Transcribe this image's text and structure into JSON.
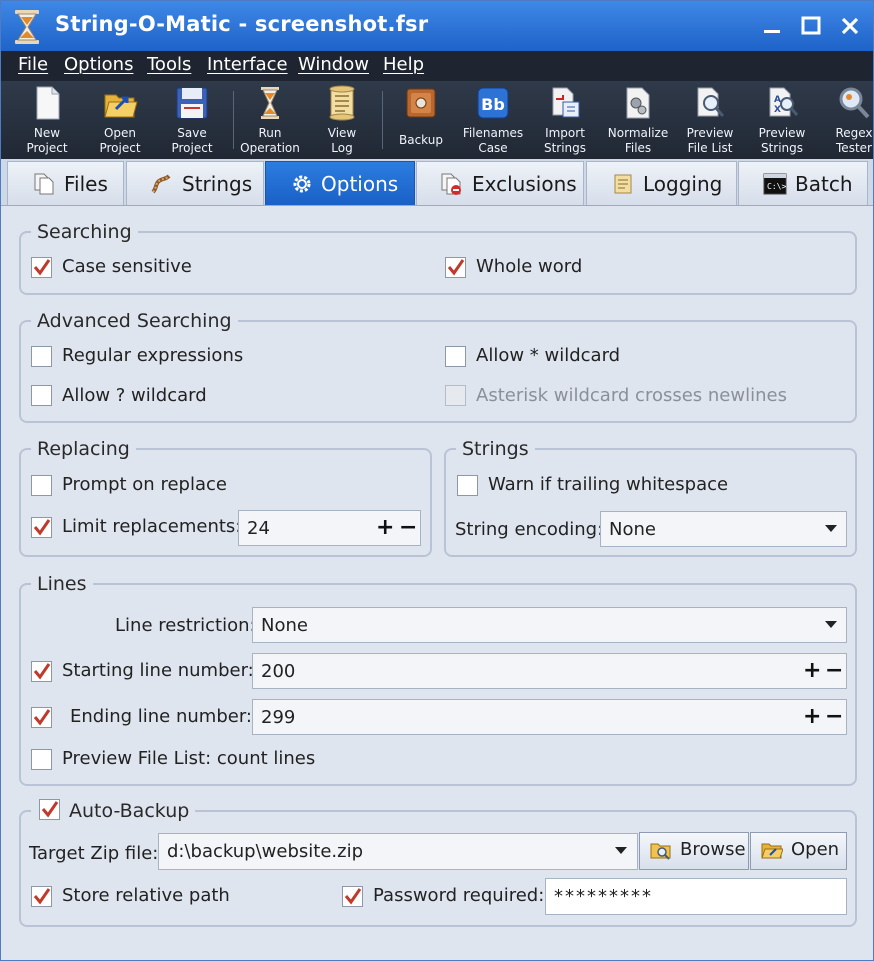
{
  "window": {
    "title": "String-O-Matic - screenshot.fsr"
  },
  "menu": [
    "File",
    "Options",
    "Tools",
    "Interface",
    "Window",
    "Help"
  ],
  "toolbar": [
    {
      "label": "New\nProject",
      "icon": "new-project-icon"
    },
    {
      "label": "Open\nProject",
      "icon": "open-project-icon"
    },
    {
      "label": "Save\nProject",
      "icon": "save-project-icon"
    },
    {
      "label": "Run\nOperation",
      "icon": "run-operation-icon"
    },
    {
      "label": "View\nLog",
      "icon": "view-log-icon"
    },
    {
      "label": "Backup",
      "icon": "backup-icon"
    },
    {
      "label": "Filenames\nCase",
      "icon": "filenames-case-icon"
    },
    {
      "label": "Import\nStrings",
      "icon": "import-strings-icon"
    },
    {
      "label": "Normalize\nFiles",
      "icon": "normalize-files-icon"
    },
    {
      "label": "Preview\nFile List",
      "icon": "preview-file-list-icon"
    },
    {
      "label": "Preview\nStrings",
      "icon": "preview-strings-icon"
    },
    {
      "label": "Regex\nTester",
      "icon": "regex-tester-icon"
    }
  ],
  "tabs": [
    {
      "label": "Files",
      "active": false
    },
    {
      "label": "Strings",
      "active": false
    },
    {
      "label": "Options",
      "active": true
    },
    {
      "label": "Exclusions",
      "active": false
    },
    {
      "label": "Logging",
      "active": false
    },
    {
      "label": "Batch",
      "active": false
    }
  ],
  "searching": {
    "legend": "Searching",
    "case_sensitive": {
      "label": "Case sensitive",
      "checked": true
    },
    "whole_word": {
      "label": "Whole word",
      "checked": true
    }
  },
  "advanced": {
    "legend": "Advanced Searching",
    "regex": {
      "label": "Regular expressions",
      "checked": false
    },
    "star_wildcard": {
      "label": "Allow * wildcard",
      "checked": false
    },
    "q_wildcard": {
      "label": "Allow ? wildcard",
      "checked": false
    },
    "asterisk_newlines": {
      "label": "Asterisk wildcard crosses newlines",
      "checked": false,
      "disabled": true
    }
  },
  "replacing": {
    "legend": "Replacing",
    "prompt": {
      "label": "Prompt on replace",
      "checked": false
    },
    "limit": {
      "label": "Limit replacements:",
      "checked": true,
      "value": "24"
    }
  },
  "strings": {
    "legend": "Strings",
    "warn": {
      "label": "Warn if trailing whitespace",
      "checked": false
    },
    "encoding_label": "String encoding:",
    "encoding_value": "None"
  },
  "lines": {
    "legend": "Lines",
    "restriction_label": "Line restriction:",
    "restriction_value": "None",
    "start": {
      "label": "Starting line number:",
      "checked": true,
      "value": "200"
    },
    "end": {
      "label": "Ending line number:",
      "checked": true,
      "value": "299"
    },
    "count": {
      "label": "Preview File List: count lines",
      "checked": false
    }
  },
  "autobackup": {
    "legend": "Auto-Backup",
    "checked": true,
    "zip_label": "Target Zip file:",
    "zip_value": "d:\\backup\\website.zip",
    "browse_label": "Browse",
    "open_label": "Open",
    "relative": {
      "label": "Store relative path",
      "checked": true
    },
    "password": {
      "label": "Password required:",
      "checked": true,
      "value": "*********"
    }
  },
  "colors": {
    "accent": "#1f66cc",
    "check": "#c0392b",
    "titlebar": "#2b74db"
  }
}
